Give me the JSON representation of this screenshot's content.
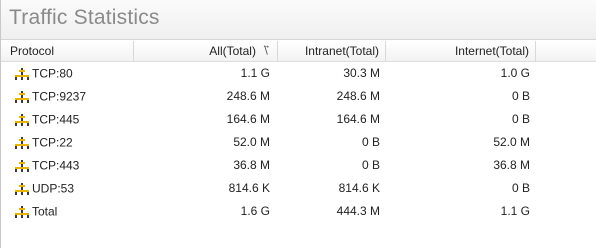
{
  "title": "Traffic Statistics",
  "columns": {
    "protocol": "Protocol",
    "all": "All(Total)",
    "intranet": "Intranet(Total)",
    "internet": "Internet(Total)"
  },
  "rows": [
    {
      "protocol": "TCP:80",
      "all": "1.1 G",
      "intranet": "30.3 M",
      "internet": "1.0 G"
    },
    {
      "protocol": "TCP:9237",
      "all": "248.6 M",
      "intranet": "248.6 M",
      "internet": "0 B"
    },
    {
      "protocol": "TCP:445",
      "all": "164.6 M",
      "intranet": "164.6 M",
      "internet": "0 B"
    },
    {
      "protocol": "TCP:22",
      "all": "52.0 M",
      "intranet": "0 B",
      "internet": "52.0 M"
    },
    {
      "protocol": "TCP:443",
      "all": "36.8 M",
      "intranet": "0 B",
      "internet": "36.8 M"
    },
    {
      "protocol": "UDP:53",
      "all": "814.6 K",
      "intranet": "814.6 K",
      "internet": "0 B"
    },
    {
      "protocol": "Total",
      "all": "1.6 G",
      "intranet": "444.3 M",
      "internet": "1.1 G"
    }
  ],
  "icons": {
    "row_icon": "network-plug-icon",
    "sort_icon": "sort-descending-icon"
  },
  "colors": {
    "title": "#8a8a8a",
    "icon_yellow": "#e8b400",
    "icon_dark": "#3a3a3a"
  }
}
